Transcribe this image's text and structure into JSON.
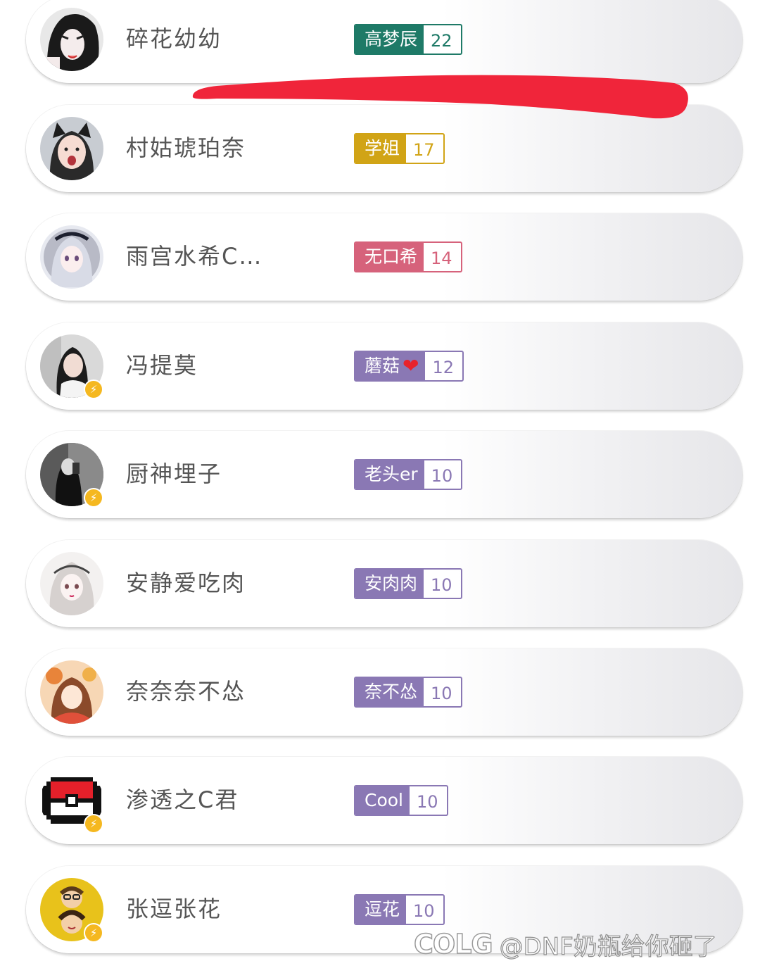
{
  "rows": [
    {
      "name": "碎花幼幼",
      "badge": {
        "title": "高梦辰",
        "level": "22",
        "color": "#1e7a67"
      },
      "vip": false,
      "avatar": "avatar-anime-dark-hair"
    },
    {
      "name": "村姑琥珀奈",
      "badge": {
        "title": "学姐",
        "level": "17",
        "color": "#d1a416"
      },
      "vip": false,
      "avatar": "avatar-cat-ears-girl"
    },
    {
      "name": "雨宫水希C…",
      "badge": {
        "title": "无口希",
        "level": "14",
        "color": "#d6627b"
      },
      "vip": false,
      "avatar": "avatar-anime-silver-hair"
    },
    {
      "name": "冯提莫",
      "badge": {
        "title": "蘑菇",
        "level": "12",
        "color": "#8a78b4",
        "heart": "❤"
      },
      "vip": true,
      "avatar": "avatar-girl-photo"
    },
    {
      "name": "厨神埋子",
      "badge": {
        "title": "老头er",
        "level": "10",
        "color": "#8a78b4"
      },
      "vip": true,
      "avatar": "avatar-mirror-selfie"
    },
    {
      "name": "安静爱吃肉",
      "badge": {
        "title": "安肉肉",
        "level": "10",
        "color": "#8a78b4"
      },
      "vip": false,
      "avatar": "avatar-anime-sketch"
    },
    {
      "name": "奈奈奈不怂",
      "badge": {
        "title": "奈不怂",
        "level": "10",
        "color": "#8a78b4"
      },
      "vip": false,
      "avatar": "avatar-anime-orange"
    },
    {
      "name": "渗透之C君",
      "badge": {
        "title": "Cool",
        "level": "10",
        "color": "#8a78b4"
      },
      "vip": true,
      "avatar": "avatar-pixel-pokeball"
    },
    {
      "name": "张逗张花",
      "badge": {
        "title": "逗花",
        "level": "10",
        "color": "#8a78b4"
      },
      "vip": true,
      "avatar": "avatar-couple-cartoon"
    }
  ],
  "watermark": {
    "logo": "COLG",
    "handle": "@DNF奶瓶给你砸了"
  },
  "colors": {
    "scribble": "#f0253a",
    "vip_badge": "#f5b820"
  },
  "icons": {
    "vip": "lightning-bolt-icon"
  }
}
